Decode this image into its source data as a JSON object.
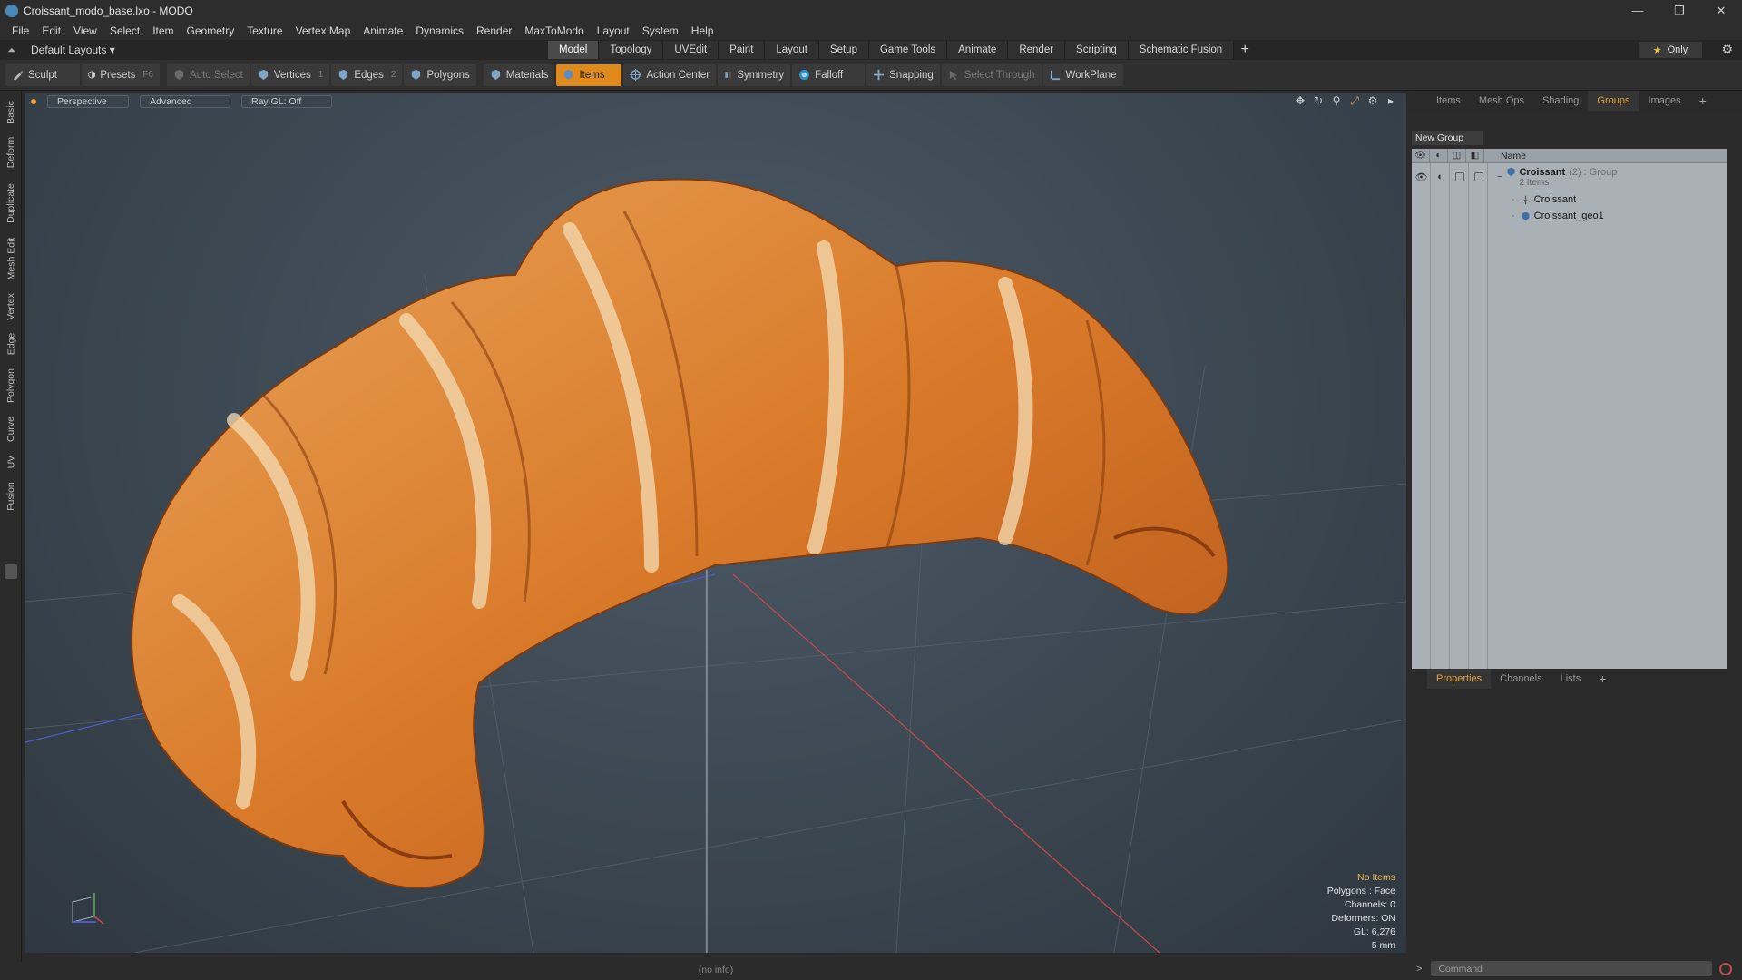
{
  "window": {
    "title": "Croissant_modo_base.lxo - MODO",
    "minimize": "—",
    "restore": "❐",
    "close": "✕"
  },
  "menu": [
    "File",
    "Edit",
    "View",
    "Select",
    "Item",
    "Geometry",
    "Texture",
    "Vertex Map",
    "Animate",
    "Dynamics",
    "Render",
    "MaxToModo",
    "Layout",
    "System",
    "Help"
  ],
  "layouts": {
    "label": "Default Layouts ▾",
    "tabs": [
      "Model",
      "Topology",
      "UVEdit",
      "Paint",
      "Layout",
      "Setup",
      "Game Tools",
      "Animate",
      "Render",
      "Scripting",
      "Schematic Fusion"
    ],
    "active_tab": "Model",
    "only_star": "★",
    "only_label": "Only"
  },
  "toolbar": {
    "sculpt": "Sculpt",
    "presets": "Presets",
    "presets_key": "F6",
    "auto_select": "Auto Select",
    "vertices": "Vertices",
    "vertices_num": "1",
    "edges": "Edges",
    "edges_num": "2",
    "polygons": "Polygons",
    "materials": "Materials",
    "items": "Items",
    "action_center": "Action Center",
    "symmetry": "Symmetry",
    "falloff": "Falloff",
    "snapping": "Snapping",
    "select_through": "Select Through",
    "workplane": "WorkPlane",
    "active_color": "#e08a1c"
  },
  "left_tabs": [
    "Basic",
    "Deform",
    "Duplicate",
    "Mesh Edit",
    "Vertex",
    "Edge",
    "Polygon",
    "Curve",
    "UV",
    "Fusion"
  ],
  "viewport": {
    "perspective": "Perspective",
    "advanced": "Advanced",
    "raygl": "Ray GL: Off",
    "hud": {
      "no_items": "No Items",
      "polygons": "Polygons : Face",
      "channels": "Channels: 0",
      "deformers": "Deformers: ON",
      "gl": "GL: 6,276",
      "unit": "5 mm"
    }
  },
  "status": {
    "info": "(no info)"
  },
  "right_panel": {
    "tabs": [
      "Items",
      "Mesh Ops",
      "Shading",
      "Groups",
      "Images"
    ],
    "active_tab": "Groups",
    "new_group": "New Group",
    "col_name": "Name",
    "group": {
      "name": "Croissant",
      "count": "(2)",
      "type": ": Group",
      "items_label": "2 Items"
    },
    "children": [
      "Croissant",
      "Croissant_geo1"
    ],
    "prop_tabs": [
      "Properties",
      "Channels",
      "Lists"
    ],
    "active_prop_tab": "Properties",
    "command_placeholder": "Command",
    "accent_color": "#e7a23c"
  }
}
